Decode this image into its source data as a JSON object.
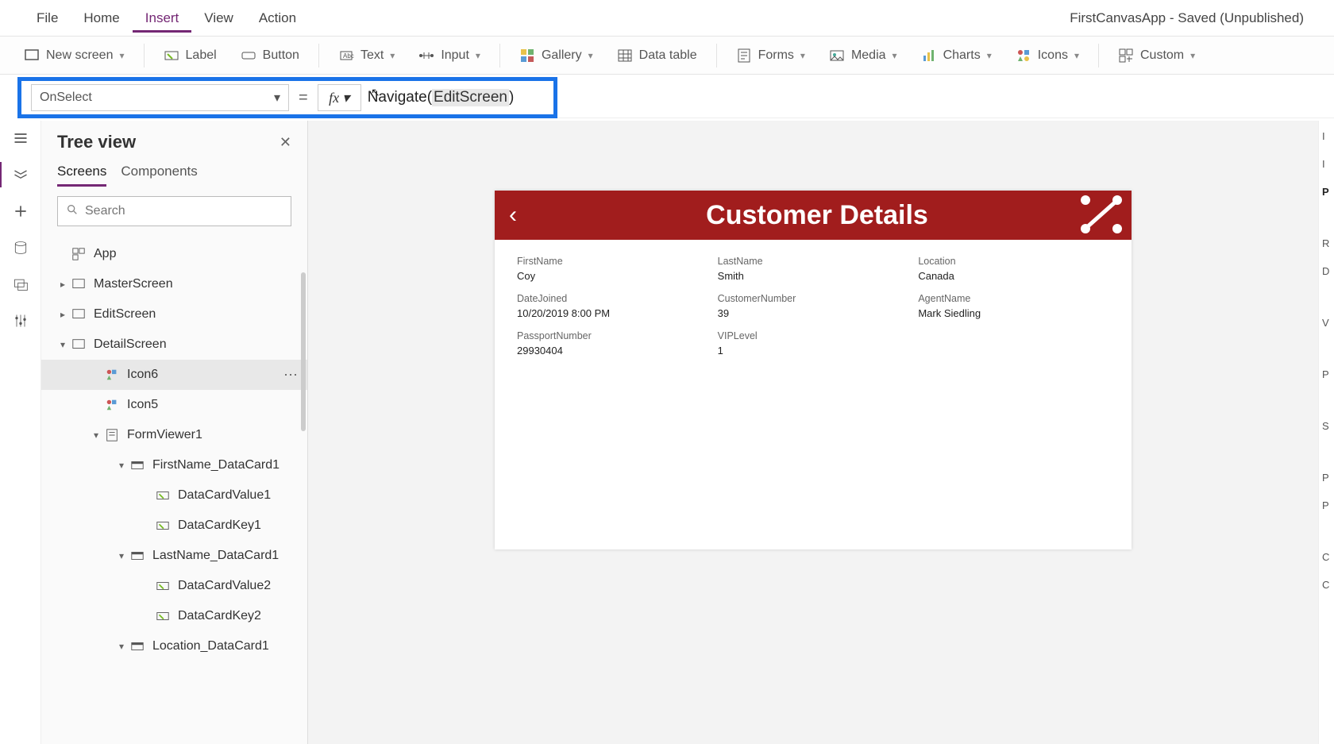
{
  "topmenu": {
    "items": [
      "File",
      "Home",
      "Insert",
      "View",
      "Action"
    ],
    "active": "Insert"
  },
  "appstatus": "FirstCanvasApp - Saved (Unpublished)",
  "ribbon": {
    "newscreen": "New screen",
    "label": "Label",
    "button": "Button",
    "text": "Text",
    "input": "Input",
    "gallery": "Gallery",
    "datatable": "Data table",
    "forms": "Forms",
    "media": "Media",
    "charts": "Charts",
    "icons": "Icons",
    "custom": "Custom"
  },
  "formulabar": {
    "property": "OnSelect",
    "equals": "=",
    "fx": "fx",
    "func": "Navigate",
    "arg": "EditScreen"
  },
  "treeview": {
    "title": "Tree view",
    "tabs": {
      "screens": "Screens",
      "components": "Components"
    },
    "searchplaceholder": "Search",
    "nodes": {
      "app": "App",
      "master": "MasterScreen",
      "edit": "EditScreen",
      "detail": "DetailScreen",
      "icon6": "Icon6",
      "icon5": "Icon5",
      "formviewer": "FormViewer1",
      "firstname": "FirstName_DataCard1",
      "dcv1": "DataCardValue1",
      "dck1": "DataCardKey1",
      "lastname": "LastName_DataCard1",
      "dcv2": "DataCardValue2",
      "dck2": "DataCardKey2",
      "location": "Location_DataCard1"
    }
  },
  "canvas": {
    "title": "Customer Details",
    "fields": {
      "firstname": {
        "label": "FirstName",
        "value": "Coy"
      },
      "lastname": {
        "label": "LastName",
        "value": "Smith"
      },
      "location": {
        "label": "Location",
        "value": "Canada"
      },
      "datejoined": {
        "label": "DateJoined",
        "value": "10/20/2019 8:00 PM"
      },
      "customernumber": {
        "label": "CustomerNumber",
        "value": "39"
      },
      "agentname": {
        "label": "AgentName",
        "value": "Mark Siedling"
      },
      "passportnumber": {
        "label": "PassportNumber",
        "value": "29930404"
      },
      "viplevel": {
        "label": "VIPLevel",
        "value": "1"
      }
    }
  },
  "rightstrip": [
    "I",
    "I",
    "P",
    "R",
    "D",
    "V",
    "P",
    "S",
    "P",
    "P",
    "C",
    "C"
  ]
}
